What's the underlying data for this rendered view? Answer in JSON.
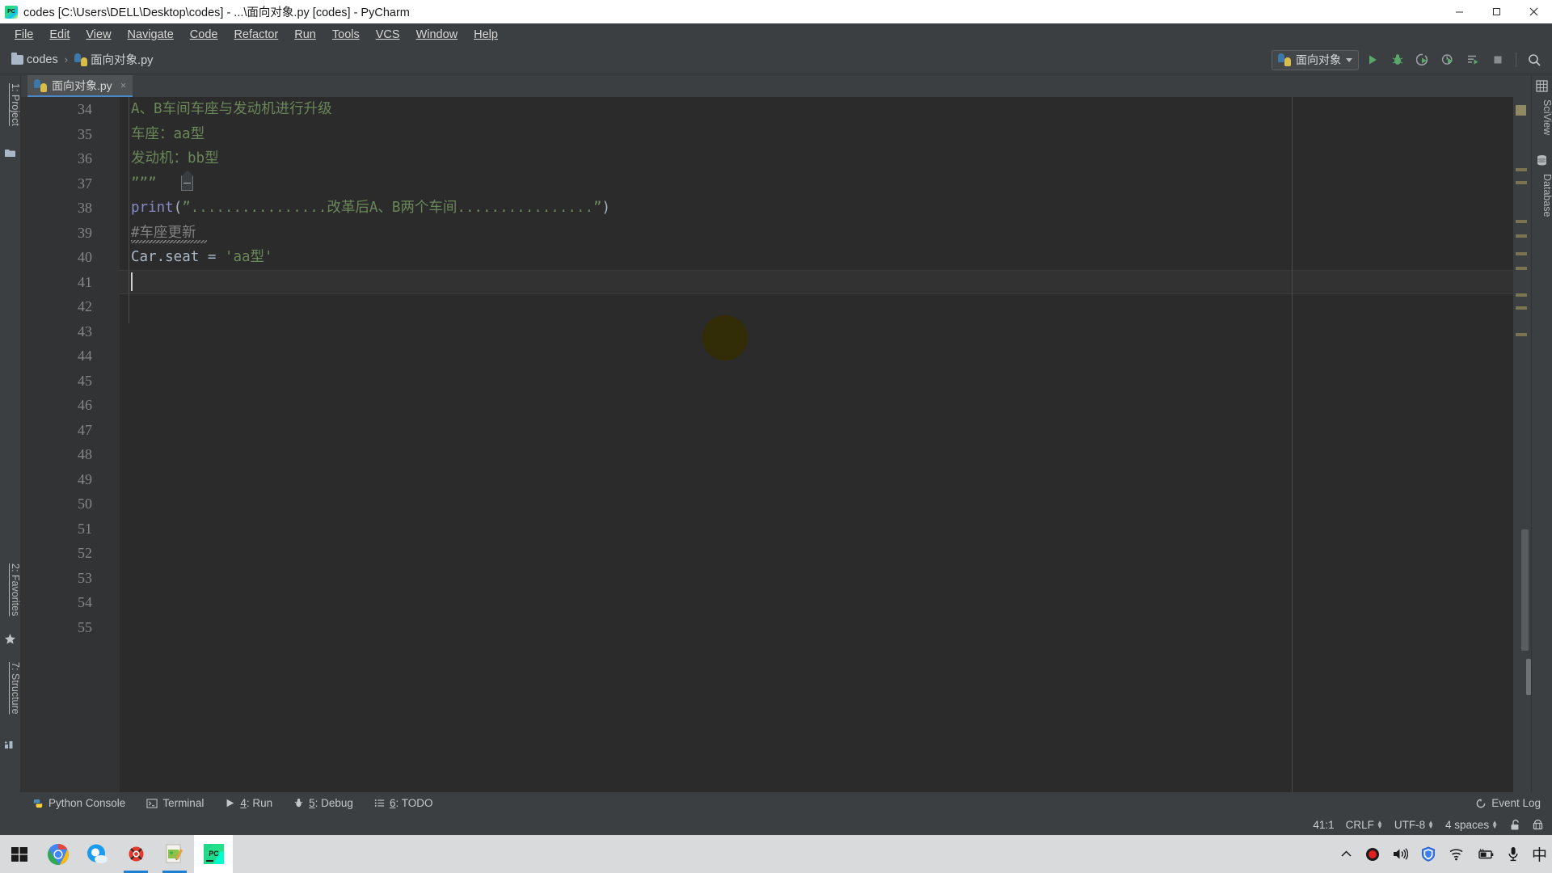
{
  "window": {
    "title": "codes [C:\\Users\\DELL\\Desktop\\codes] - ...\\面向对象.py [codes] - PyCharm",
    "minimize_label": "Minimize",
    "maximize_label": "Maximize",
    "close_label": "Close"
  },
  "menubar": {
    "items": [
      {
        "label": "File"
      },
      {
        "label": "Edit"
      },
      {
        "label": "View"
      },
      {
        "label": "Navigate"
      },
      {
        "label": "Code"
      },
      {
        "label": "Refactor"
      },
      {
        "label": "Run"
      },
      {
        "label": "Tools"
      },
      {
        "label": "VCS"
      },
      {
        "label": "Window"
      },
      {
        "label": "Help"
      }
    ]
  },
  "navbar": {
    "breadcrumb": {
      "project": "codes",
      "separator": "›",
      "file": "面向对象.py"
    },
    "run_config": {
      "name": "面向对象",
      "icon": "python-icon",
      "caret": "chevron-down-icon"
    },
    "actions": [
      {
        "name": "run-button",
        "label": "Run"
      },
      {
        "name": "debug-button",
        "label": "Debug"
      },
      {
        "name": "run-with-coverage-button",
        "label": "Run with Coverage"
      },
      {
        "name": "profile-button",
        "label": "Profile"
      },
      {
        "name": "run-dashboard-button",
        "label": "Run Dashboard"
      },
      {
        "name": "stop-button",
        "label": "Stop"
      },
      {
        "name": "search-everywhere-button",
        "label": "Search Everywhere"
      }
    ]
  },
  "tabs": [
    {
      "label": "面向对象.py",
      "close": "×",
      "active": true
    }
  ],
  "left_strip": [
    {
      "label": "1: Project",
      "key": "1",
      "text": ": Project",
      "icon": "folder-icon"
    },
    {
      "label": "2: Favorites",
      "key": "2",
      "text": ": Favorites",
      "icon": "star-icon"
    },
    {
      "label": "7: Structure",
      "key": "7",
      "text": ": Structure",
      "icon": "structure-icon"
    }
  ],
  "right_strip": [
    {
      "label": "SciView",
      "icon": "grid-icon"
    },
    {
      "label": "Database",
      "icon": "database-icon"
    }
  ],
  "editor": {
    "first_line": 34,
    "line_numbers": [
      34,
      35,
      36,
      37,
      38,
      39,
      40,
      41,
      42,
      43,
      44,
      45,
      46,
      47,
      48,
      49,
      50,
      51,
      52,
      53,
      54,
      55
    ],
    "cursor_line": 41,
    "lines": [
      {
        "num": 34,
        "text": "A、B车间车座与发动机进行升级",
        "type": "docstring"
      },
      {
        "num": 35,
        "text": "车座：aa型",
        "type": "docstring"
      },
      {
        "num": 36,
        "text": "发动机：bb型",
        "type": "docstring"
      },
      {
        "num": 37,
        "text": "”””",
        "type": "docstring",
        "fold": true
      },
      {
        "num": 38,
        "type": "code",
        "parts": [
          {
            "t": "print",
            "c": "keyword"
          },
          {
            "t": "(",
            "c": "punct"
          },
          {
            "t": "”................改革后A、B两个车间................”",
            "c": "string"
          },
          {
            "t": ")",
            "c": "punct"
          }
        ]
      },
      {
        "num": 39,
        "text": "#车座更新",
        "type": "comment",
        "warning": true
      },
      {
        "num": 40,
        "type": "code",
        "parts": [
          {
            "t": "Car.seat",
            "c": "identifier"
          },
          {
            "t": " = ",
            "c": "punct"
          },
          {
            "t": "'aa型'",
            "c": "string"
          }
        ]
      },
      {
        "num": 41,
        "text": "",
        "type": "empty",
        "cursor": true
      }
    ]
  },
  "bottom_bar": {
    "items": [
      {
        "label": "Python Console",
        "key": "",
        "icon": "python-console-icon"
      },
      {
        "label": "Terminal",
        "key": "",
        "icon": "terminal-icon"
      },
      {
        "label": "4: Run",
        "key": "4",
        "text": ": Run",
        "icon": "run-icon"
      },
      {
        "label": "5: Debug",
        "key": "5",
        "text": ": Debug",
        "icon": "debug-icon"
      },
      {
        "label": "6: TODO",
        "key": "6",
        "text": ": TODO",
        "icon": "todo-icon"
      }
    ],
    "event_log": {
      "label": "Event Log",
      "icon": "event-log-icon"
    }
  },
  "status_bar": {
    "caret_position": "41:1",
    "line_separator": "CRLF",
    "encoding": "UTF-8",
    "indent": "4 spaces",
    "lock_icon": "unlocked-icon",
    "inspection_icon": "hector-icon"
  },
  "taskbar": {
    "items": [
      {
        "name": "start-button",
        "label": "Start",
        "icon": "windows-logo-icon"
      },
      {
        "name": "taskbar-chrome",
        "label": "Google Chrome",
        "icon": "chrome-icon"
      },
      {
        "name": "taskbar-qq-browser",
        "label": "QQ Browser",
        "icon": "qq-browser-icon"
      },
      {
        "name": "taskbar-app-red",
        "label": "App",
        "icon": "red-app-icon",
        "running": true
      },
      {
        "name": "taskbar-editor",
        "label": "Editor",
        "icon": "editor-icon",
        "running": true
      },
      {
        "name": "taskbar-pycharm",
        "label": "PyCharm",
        "icon": "pycharm-icon",
        "running": true,
        "active": true
      }
    ],
    "tray": [
      {
        "name": "tray-show-hidden",
        "label": "Show hidden icons",
        "icon": "chevron-up-icon"
      },
      {
        "name": "tray-recorder",
        "label": "Recorder",
        "icon": "record-dot-icon"
      },
      {
        "name": "tray-volume",
        "label": "Volume",
        "icon": "speaker-icon"
      },
      {
        "name": "tray-security",
        "label": "Security",
        "icon": "shield-icon"
      },
      {
        "name": "tray-network",
        "label": "Network",
        "icon": "wifi-icon"
      },
      {
        "name": "tray-battery",
        "label": "Battery",
        "icon": "battery-icon"
      },
      {
        "name": "tray-microphone",
        "label": "Microphone",
        "icon": "microphone-icon"
      },
      {
        "name": "tray-ime",
        "label": "中",
        "icon": "ime-icon"
      }
    ],
    "ime_label": "中"
  },
  "colors": {
    "ide_bg": "#3c3f41",
    "editor_bg": "#2b2b2b",
    "accent": "#4a88c7",
    "docstring": "#6a8759",
    "keyword": "#8888c6",
    "comment": "#808080",
    "identifier": "#a9b7c6",
    "taskbar": "#d9dadb"
  }
}
